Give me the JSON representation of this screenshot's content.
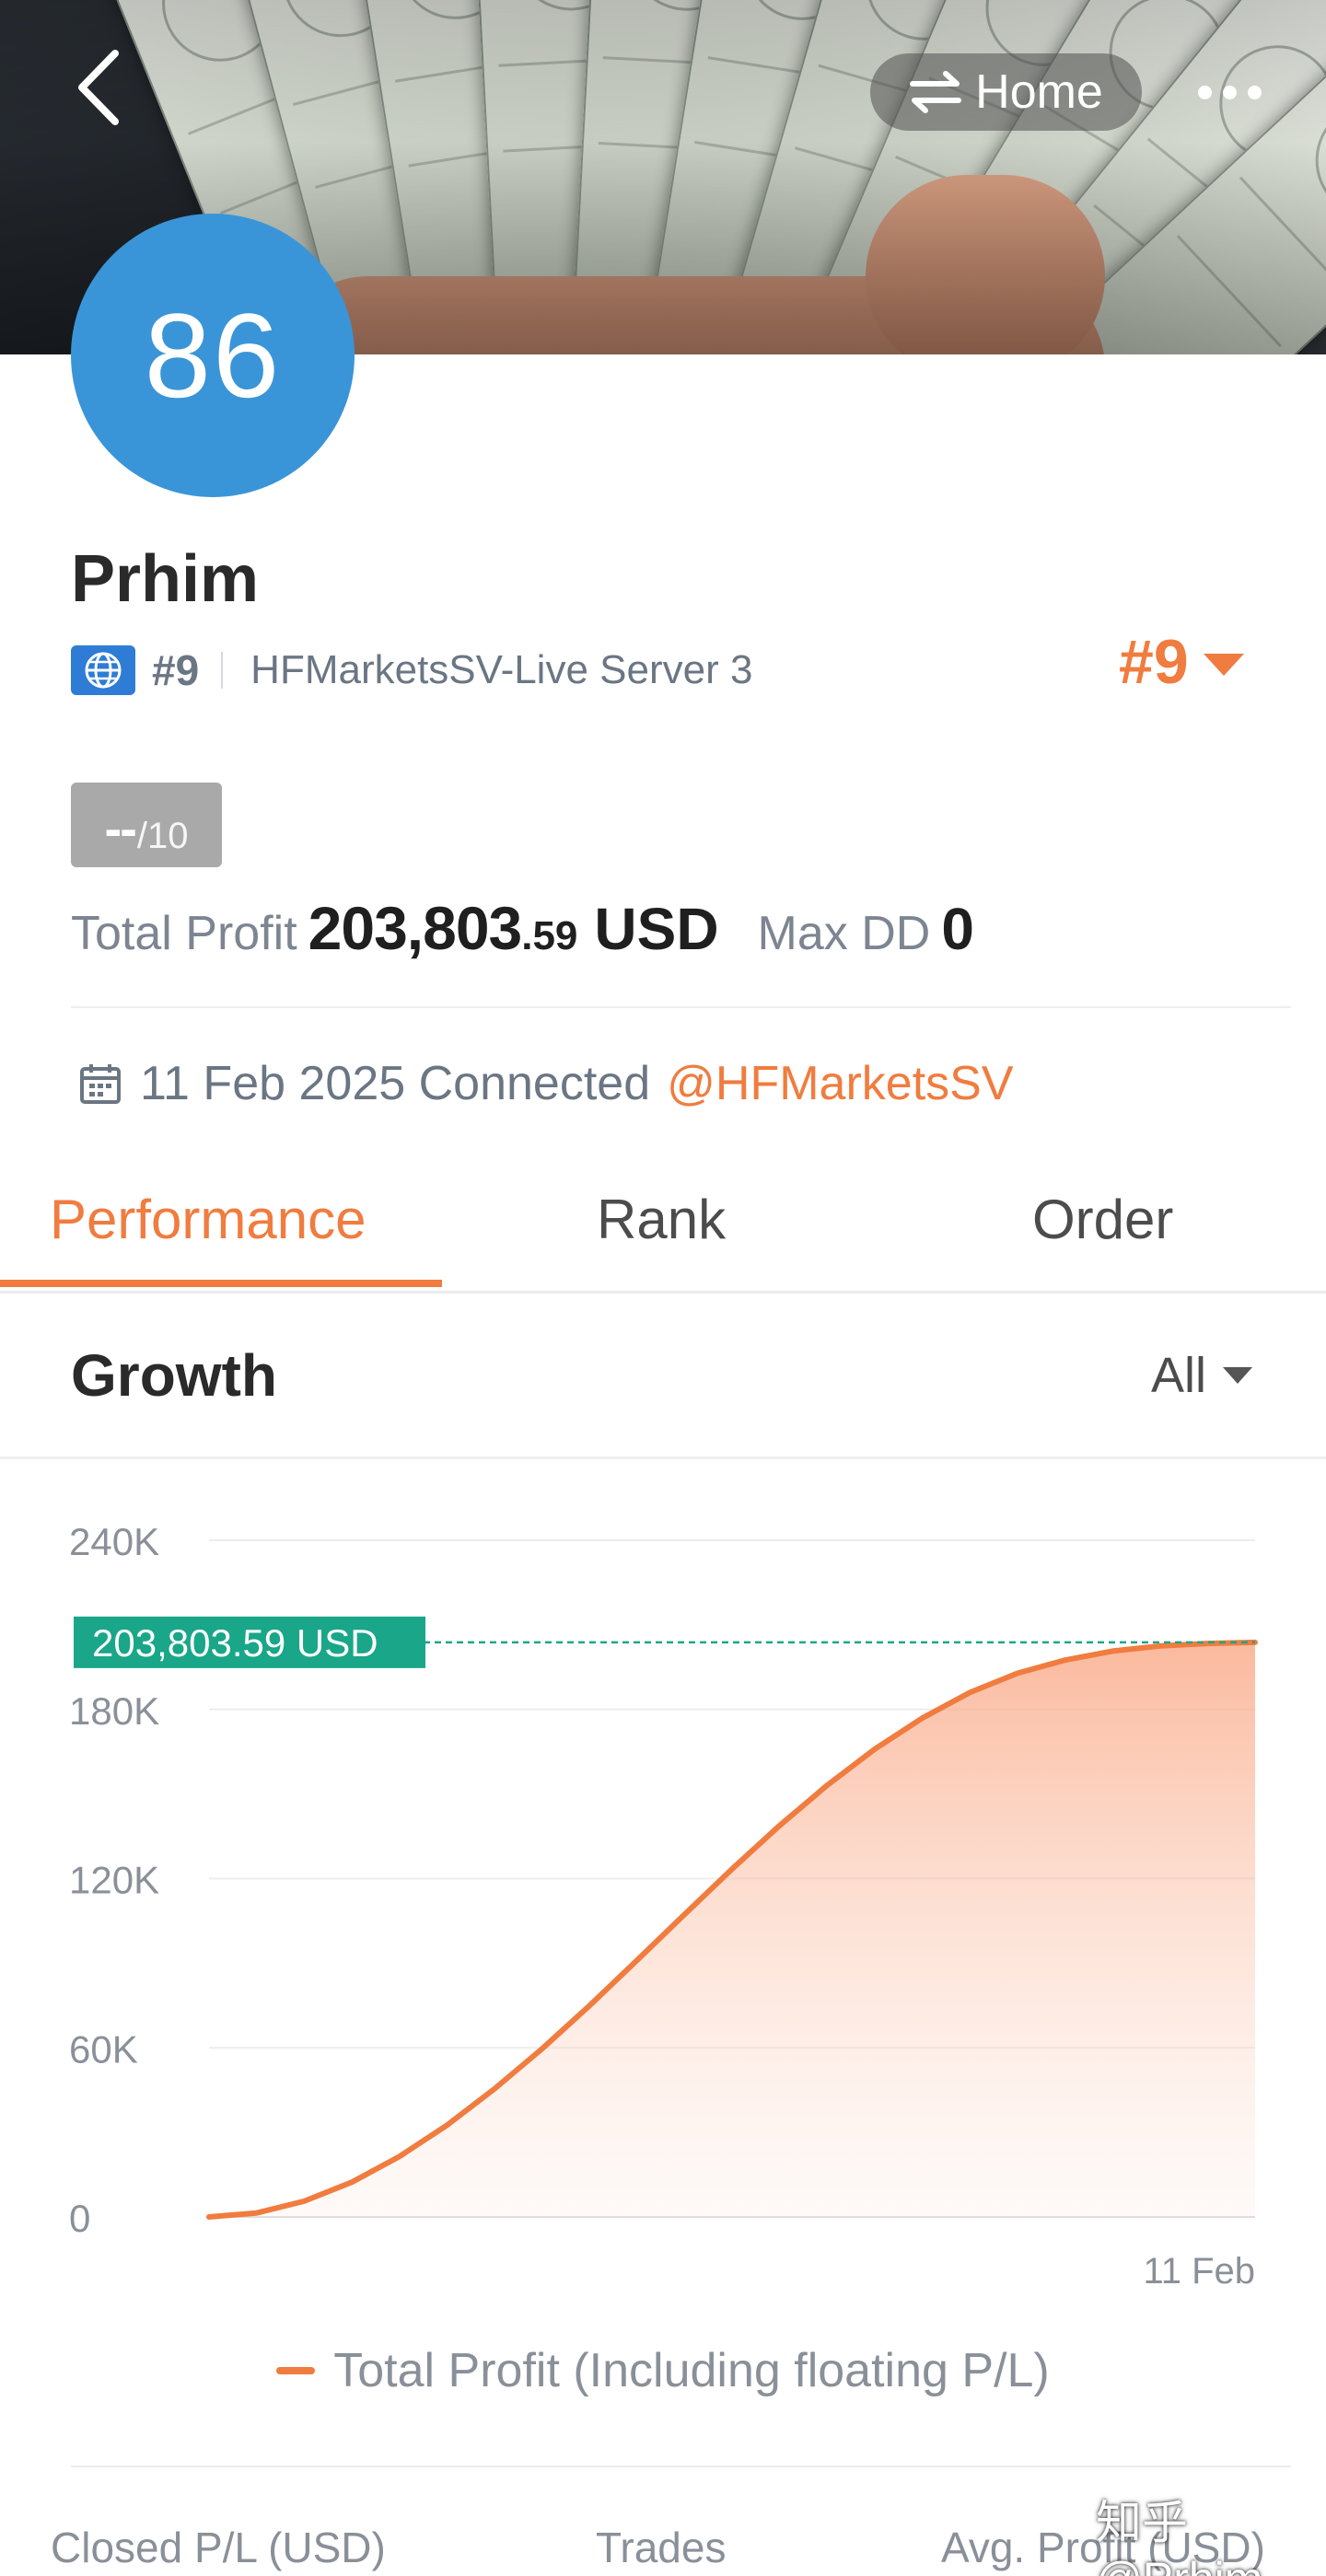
{
  "header": {
    "home_label": "Home",
    "back_icon": "chevron-left-icon",
    "home_icon": "swap-arrows-icon",
    "more_icon": "more-dots-icon"
  },
  "profile": {
    "avatar_text": "86",
    "avatar_color": "#3a95d8",
    "name": "Prhim",
    "rank_small": "#9",
    "server": "HFMarketsSV-Live Server 3",
    "rank_big": "#9",
    "score_main": "--",
    "score_den": "/10",
    "total_profit_label": "Total Profit",
    "total_profit_int": "203,803",
    "total_profit_dec": ".59",
    "total_profit_currency": "USD",
    "max_dd_label": "Max DD",
    "max_dd_value": "0",
    "connected_date": "11 Feb 2025 Connected",
    "broker_handle": "@HFMarketsSV"
  },
  "tabs": [
    {
      "label": "Performance",
      "active": true
    },
    {
      "label": "Rank",
      "active": false
    },
    {
      "label": "Order",
      "active": false
    }
  ],
  "growth": {
    "title": "Growth",
    "range": "All"
  },
  "chart_data": {
    "type": "area",
    "y_ticks": [
      "240K",
      "180K",
      "120K",
      "60K",
      "0"
    ],
    "ylim": [
      0,
      240000
    ],
    "x_tick_labels": [
      "11 Feb"
    ],
    "series": [
      {
        "name": "Total Profit (Including floating P/L)",
        "color": "#f07c3f",
        "values": [
          0,
          1400,
          5600,
          12300,
          21400,
          32500,
          45400,
          59600,
          74900,
          91000,
          107300,
          123400,
          138800,
          153100,
          165900,
          176900,
          186000,
          192800,
          197500,
          200700,
          202500,
          203400,
          203803.59
        ]
      }
    ],
    "marker": {
      "label": "203,803.59 USD",
      "value": 203803.59,
      "color": "#1aa688"
    }
  },
  "legend": {
    "label": "Total Profit (Including floating P/L)"
  },
  "stats": {
    "closed_pl": "Closed P/L (USD)",
    "trades": "Trades",
    "avg_profit": "Avg. Profit (USD)"
  },
  "watermark": "知乎 @Prhim",
  "colors": {
    "accent": "#f07c3f",
    "marker": "#1aa688"
  }
}
